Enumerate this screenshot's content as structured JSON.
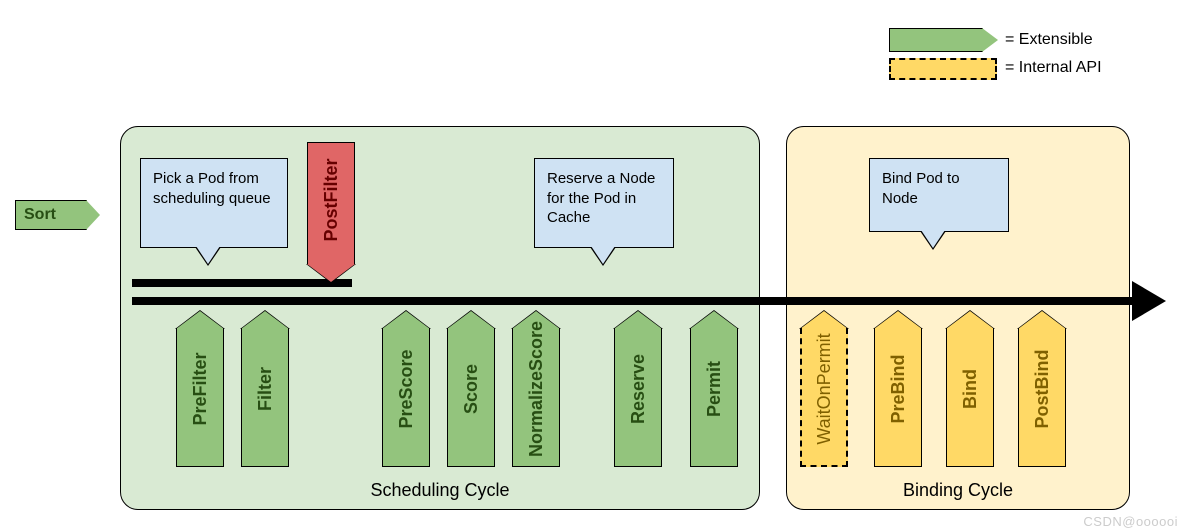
{
  "legend": {
    "extensible": "= Extensible",
    "internal": "= Internal API"
  },
  "sort": "Sort",
  "sched_cycle": {
    "label": "Scheduling Cycle"
  },
  "bind_cycle": {
    "label": "Binding Cycle"
  },
  "tooltips": {
    "pick": "Pick a Pod from scheduling queue",
    "reserve": "Reserve a Node for the Pod in Cache",
    "bind": "Bind Pod to Node"
  },
  "ext": {
    "postfilter": "PostFilter",
    "prefilter": "PreFilter",
    "filter": "Filter",
    "prescore": "PreScore",
    "score": "Score",
    "normalize_l1": "Normalize",
    "normalize_l2": "Score",
    "reserve": "Reserve",
    "permit": "Permit",
    "wait": "WaitOnPermit",
    "prebind": "PreBind",
    "bind": "Bind",
    "postbind": "PostBind"
  },
  "watermark": "CSDN@oooooi"
}
